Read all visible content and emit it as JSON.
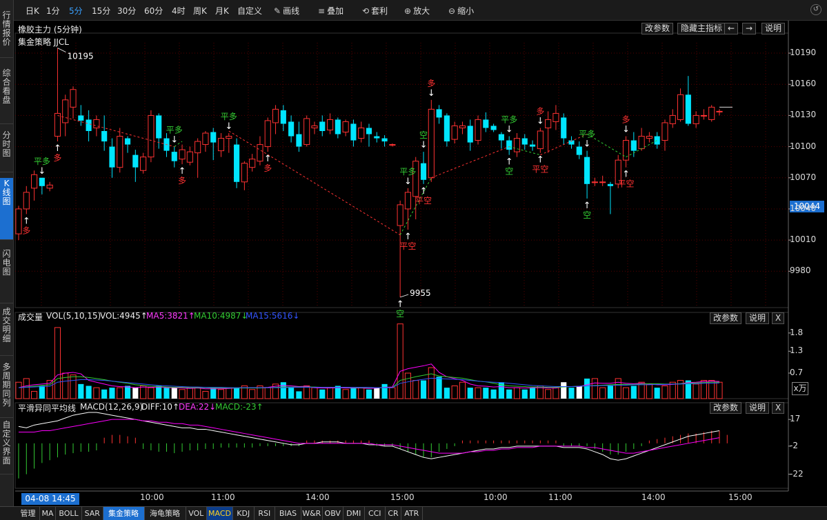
{
  "toolbar": {
    "periods": [
      "日K",
      "1分",
      "5分",
      "15分",
      "30分",
      "60分",
      "4时",
      "周K",
      "月K",
      "自定义"
    ],
    "selected_period": "5分",
    "tools": [
      {
        "label": "画线",
        "icon": "pencil-icon"
      },
      {
        "label": "叠加",
        "icon": "stack-icon"
      },
      {
        "label": "套利",
        "icon": "arbitrage-icon"
      },
      {
        "label": "放大",
        "icon": "zoom-in-icon"
      },
      {
        "label": "缩小",
        "icon": "zoom-out-icon"
      }
    ]
  },
  "sidebar": {
    "tabs": [
      "行情报价",
      "综合看盘",
      "分时图",
      "K线图",
      "闪电图",
      "成交明细",
      "多周期同列",
      "自定义界面"
    ],
    "active": "K线图"
  },
  "price_panel": {
    "title": "橡胶主力 (5分钟)",
    "strategy_label": "集金策略 JJCL",
    "buttons": [
      "改参数",
      "隐藏主指标",
      "←",
      "→",
      "说明"
    ],
    "high_label": "10195",
    "low_label": "9955",
    "current_price": "10044",
    "y_ticks": [
      "10190",
      "10160",
      "10130",
      "10100",
      "10070",
      "10040",
      "10010",
      "9980"
    ]
  },
  "volume_panel": {
    "name": "成交量",
    "params": "VOL(5,10,15)",
    "vol": "VOL:4945↑",
    "ma5": "MA5:3821↑",
    "ma10": "MA10:4987↓",
    "ma15": "MA15:5616↓",
    "buttons": [
      "改参数",
      "说明",
      "X"
    ],
    "y_ticks": [
      "1.8",
      "1.3",
      "0.7"
    ],
    "unit": "x万"
  },
  "macd_panel": {
    "name": "平滑异同平均线",
    "params": "MACD(12,26,9)",
    "diff": "DIFF:10↑",
    "dea": "DEA:22↓",
    "macd": "MACD:-23↑",
    "buttons": [
      "改参数",
      "说明",
      "X"
    ],
    "y_ticks": [
      "17",
      "-2",
      "-22"
    ]
  },
  "time_axis": {
    "current": "04-08 14:45",
    "ticks": [
      "10:00",
      "11:00",
      "14:00",
      "15:00",
      "10:00",
      "11:00",
      "14:00",
      "15:00"
    ]
  },
  "bottom_tabs": [
    "管理",
    "MA",
    "BOLL",
    "SAR",
    "集金策略",
    "海龟策略",
    "VOL",
    "MACD",
    "KDJ",
    "RSI",
    "BIAS",
    "W&R",
    "OBV",
    "DMI",
    "CCI",
    "CR",
    "ATR"
  ],
  "bottom_active": "集金策略",
  "bottom_highlight": "MACD",
  "colors": {
    "up": "#ff3232",
    "down": "#00e5ff",
    "signal_long": "#ff3232",
    "signal_short": "#33cc33",
    "ma5": "#ff00ff",
    "ma10": "#33cc33",
    "ma15": "#3355ff",
    "accent": "#1c6fd0"
  },
  "chart_data": {
    "type": "candlestick",
    "bars": [
      [
        10016,
        10040,
        10010,
        10043
      ],
      [
        10040,
        10056,
        10035,
        10062
      ],
      [
        10060,
        10073,
        10048,
        10077
      ],
      [
        10070,
        10062,
        10054,
        10070
      ],
      [
        10060,
        10063,
        10057,
        10066
      ],
      [
        10110,
        10132,
        10105,
        10195
      ],
      [
        10123,
        10145,
        10110,
        10150
      ],
      [
        10138,
        10155,
        10127,
        10158
      ],
      [
        10130,
        10125,
        10120,
        10140
      ],
      [
        10126,
        10115,
        10105,
        10135
      ],
      [
        10118,
        10126,
        10110,
        10130
      ],
      [
        10115,
        10105,
        10096,
        10130
      ],
      [
        10100,
        10080,
        10070,
        10108
      ],
      [
        10080,
        10110,
        10075,
        10118
      ],
      [
        10108,
        10102,
        10094,
        10110
      ],
      [
        10092,
        10080,
        10066,
        10097
      ],
      [
        10077,
        10090,
        10074,
        10094
      ],
      [
        10090,
        10130,
        10085,
        10135
      ],
      [
        10130,
        10108,
        10098,
        10132
      ],
      [
        10108,
        10096,
        10090,
        10113
      ],
      [
        10095,
        10086,
        10080,
        10100
      ],
      [
        10088,
        10097,
        10083,
        10102
      ],
      [
        10085,
        10095,
        10082,
        10100
      ],
      [
        10094,
        10105,
        10070,
        10108
      ],
      [
        10102,
        10113,
        10095,
        10115
      ],
      [
        10114,
        10104,
        10087,
        10118
      ],
      [
        10096,
        10108,
        10090,
        10113
      ],
      [
        10108,
        10110,
        10094,
        10113
      ],
      [
        10102,
        10066,
        10060,
        10108
      ],
      [
        10066,
        10084,
        10058,
        10086
      ],
      [
        10080,
        10088,
        10076,
        10093
      ],
      [
        10086,
        10102,
        10082,
        10110
      ],
      [
        10100,
        10125,
        10095,
        10128
      ],
      [
        10123,
        10136,
        10112,
        10140
      ],
      [
        10135,
        10122,
        10115,
        10140
      ],
      [
        10124,
        10110,
        10104,
        10130
      ],
      [
        10112,
        10100,
        10095,
        10124
      ],
      [
        10102,
        10127,
        10100,
        10130
      ],
      [
        10118,
        10120,
        10112,
        10124
      ],
      [
        10124,
        10115,
        10110,
        10130
      ],
      [
        10116,
        10126,
        10112,
        10132
      ],
      [
        10126,
        10112,
        10108,
        10128
      ],
      [
        10114,
        10124,
        10110,
        10126
      ],
      [
        10122,
        10106,
        10100,
        10126
      ],
      [
        10108,
        10118,
        10104,
        10124
      ],
      [
        10118,
        10112,
        10100,
        10122
      ],
      [
        10110,
        10108,
        10104,
        10114
      ],
      [
        10108,
        10105,
        10100,
        10111
      ],
      [
        10102,
        10102,
        10100,
        10103
      ],
      [
        10024,
        10044,
        9955,
        10048
      ],
      [
        10040,
        10056,
        10020,
        10060
      ],
      [
        10052,
        10086,
        10030,
        10090
      ],
      [
        10084,
        10068,
        10064,
        10095
      ],
      [
        10070,
        10136,
        10066,
        10145
      ],
      [
        10136,
        10128,
        10122,
        10140
      ],
      [
        10130,
        10105,
        10100,
        10132
      ],
      [
        10107,
        10120,
        10103,
        10124
      ],
      [
        10118,
        10120,
        10112,
        10124
      ],
      [
        10120,
        10104,
        10096,
        10126
      ],
      [
        10106,
        10126,
        10102,
        10130
      ],
      [
        10126,
        10118,
        10114,
        10133
      ],
      [
        10120,
        10116,
        10114,
        10122
      ],
      [
        10112,
        10106,
        10098,
        10114
      ],
      [
        10106,
        10097,
        10092,
        10110
      ],
      [
        10095,
        10108,
        10090,
        10113
      ],
      [
        10108,
        10102,
        10097,
        10112
      ],
      [
        10102,
        10100,
        10096,
        10106
      ],
      [
        10098,
        10115,
        10094,
        10118
      ],
      [
        10118,
        10126,
        10094,
        10134
      ],
      [
        10124,
        10132,
        10116,
        10140
      ],
      [
        10128,
        10108,
        10102,
        10132
      ],
      [
        10106,
        10102,
        10098,
        10110
      ],
      [
        10100,
        10092,
        10088,
        10105
      ],
      [
        10090,
        10064,
        10050,
        10096
      ],
      [
        10066,
        10066,
        10062,
        10070
      ],
      [
        10066,
        10066,
        10062,
        10072
      ],
      [
        10064,
        10062,
        10035,
        10066
      ],
      [
        10064,
        10087,
        10060,
        10092
      ],
      [
        10087,
        10106,
        10080,
        10110
      ],
      [
        10106,
        10096,
        10090,
        10114
      ],
      [
        10098,
        10110,
        10096,
        10118
      ],
      [
        10108,
        10110,
        10104,
        10114
      ],
      [
        10110,
        10102,
        10098,
        10114
      ],
      [
        10106,
        10123,
        10096,
        10126
      ],
      [
        10122,
        10130,
        10118,
        10136
      ],
      [
        10126,
        10150,
        10124,
        10156
      ],
      [
        10150,
        10122,
        10120,
        10168
      ],
      [
        10122,
        10130,
        10118,
        10134
      ],
      [
        10130,
        10130,
        10126,
        10136
      ],
      [
        10126,
        10138,
        10124,
        10140
      ],
      [
        10134,
        10134,
        10130,
        10136
      ]
    ],
    "volume": [
      0.45,
      0.55,
      0.2,
      0.35,
      0.5,
      1.95,
      0.7,
      0.65,
      0.4,
      0.35,
      0.3,
      0.25,
      0.3,
      0.3,
      0.35,
      0.3,
      0.35,
      0.3,
      0.35,
      0.3,
      0.3,
      0.25,
      0.3,
      0.3,
      0.2,
      0.3,
      0.25,
      0.3,
      0.3,
      0.35,
      0.25,
      0.35,
      0.3,
      0.4,
      0.45,
      0.3,
      0.2,
      0.35,
      0.3,
      0.25,
      0.3,
      0.35,
      0.25,
      0.3,
      0.3,
      0.25,
      0.3,
      0.4,
      0.3,
      2.05,
      0.7,
      0.5,
      0.5,
      0.85,
      0.6,
      0.3,
      0.35,
      0.45,
      0.3,
      0.3,
      0.3,
      0.25,
      0.45,
      0.25,
      0.3,
      0.25,
      0.3,
      0.35,
      0.25,
      0.3,
      0.45,
      0.3,
      0.35,
      0.55,
      0.55,
      0.3,
      0.35,
      0.55,
      0.3,
      0.35,
      0.45,
      0.4,
      0.3,
      0.35,
      0.45,
      0.5,
      0.5,
      0.4,
      0.5,
      0.5,
      0.45
    ],
    "signals": [
      {
        "i": 1,
        "text": "多",
        "type": "long",
        "pos": "below"
      },
      {
        "i": 3,
        "text": "平多",
        "type": "short",
        "pos": "above"
      },
      {
        "i": 5,
        "text": "多",
        "type": "long",
        "pos": "below"
      },
      {
        "i": 20,
        "text": "平多",
        "type": "short",
        "pos": "above"
      },
      {
        "i": 21,
        "text": "多",
        "type": "long",
        "pos": "below"
      },
      {
        "i": 27,
        "text": "平多",
        "type": "short",
        "pos": "above"
      },
      {
        "i": 32,
        "text": "多",
        "type": "long",
        "pos": "below"
      },
      {
        "i": 49,
        "text": "空",
        "type": "short",
        "pos": "below"
      },
      {
        "i": 50,
        "text": "平多",
        "type": "short",
        "pos": "above"
      },
      {
        "i": 50,
        "text": "平空",
        "type": "long",
        "pos": "below"
      },
      {
        "i": 52,
        "text": "空",
        "type": "short",
        "pos": "above"
      },
      {
        "i": 52,
        "text": "平空",
        "type": "long",
        "pos": "below"
      },
      {
        "i": 53,
        "text": "多",
        "type": "long",
        "pos": "above"
      },
      {
        "i": 63,
        "text": "平多",
        "type": "short",
        "pos": "above"
      },
      {
        "i": 63,
        "text": "空",
        "type": "short",
        "pos": "below"
      },
      {
        "i": 67,
        "text": "多",
        "type": "long",
        "pos": "above"
      },
      {
        "i": 67,
        "text": "平空",
        "type": "long",
        "pos": "below"
      },
      {
        "i": 73,
        "text": "平多",
        "type": "short",
        "pos": "above"
      },
      {
        "i": 73,
        "text": "空",
        "type": "short",
        "pos": "below"
      },
      {
        "i": 78,
        "text": "多",
        "type": "long",
        "pos": "above"
      },
      {
        "i": 78,
        "text": "平空",
        "type": "long",
        "pos": "below"
      }
    ],
    "ma5": [
      0.3,
      0.35,
      0.38,
      0.4,
      0.42,
      0.65,
      0.7,
      0.72,
      0.68,
      0.5,
      0.45,
      0.4,
      0.35,
      0.33,
      0.32,
      0.3,
      0.32,
      0.31,
      0.32,
      0.3,
      0.3,
      0.29,
      0.28,
      0.29,
      0.27,
      0.27,
      0.27,
      0.28,
      0.29,
      0.3,
      0.3,
      0.3,
      0.31,
      0.34,
      0.36,
      0.35,
      0.33,
      0.34,
      0.3,
      0.29,
      0.29,
      0.3,
      0.29,
      0.29,
      0.29,
      0.28,
      0.29,
      0.31,
      0.32,
      0.75,
      0.82,
      0.86,
      0.9,
      0.95,
      0.72,
      0.6,
      0.55,
      0.5,
      0.4,
      0.35,
      0.34,
      0.32,
      0.33,
      0.3,
      0.3,
      0.29,
      0.3,
      0.3,
      0.29,
      0.29,
      0.33,
      0.33,
      0.33,
      0.38,
      0.43,
      0.42,
      0.42,
      0.45,
      0.42,
      0.41,
      0.42,
      0.4,
      0.38,
      0.38,
      0.39,
      0.41,
      0.44,
      0.45,
      0.47,
      0.48,
      0.47
    ],
    "ma10": [
      0.3,
      0.32,
      0.34,
      0.36,
      0.38,
      0.55,
      0.58,
      0.6,
      0.6,
      0.58,
      0.55,
      0.52,
      0.48,
      0.45,
      0.42,
      0.38,
      0.36,
      0.34,
      0.33,
      0.32,
      0.31,
      0.31,
      0.3,
      0.3,
      0.3,
      0.29,
      0.29,
      0.29,
      0.29,
      0.29,
      0.29,
      0.29,
      0.3,
      0.31,
      0.32,
      0.32,
      0.32,
      0.32,
      0.32,
      0.31,
      0.31,
      0.31,
      0.31,
      0.3,
      0.3,
      0.3,
      0.3,
      0.3,
      0.3,
      0.5,
      0.55,
      0.6,
      0.64,
      0.68,
      0.62,
      0.6,
      0.58,
      0.56,
      0.52,
      0.48,
      0.46,
      0.42,
      0.38,
      0.35,
      0.34,
      0.33,
      0.32,
      0.32,
      0.31,
      0.31,
      0.32,
      0.33,
      0.34,
      0.35,
      0.36,
      0.37,
      0.38,
      0.39,
      0.39,
      0.39,
      0.4,
      0.41,
      0.41,
      0.4,
      0.4,
      0.41,
      0.42,
      0.43,
      0.44,
      0.45,
      0.45
    ],
    "ma15": [
      0.3,
      0.31,
      0.32,
      0.33,
      0.34,
      0.45,
      0.48,
      0.5,
      0.52,
      0.52,
      0.51,
      0.5,
      0.48,
      0.46,
      0.44,
      0.42,
      0.4,
      0.38,
      0.36,
      0.35,
      0.34,
      0.33,
      0.32,
      0.32,
      0.31,
      0.31,
      0.31,
      0.3,
      0.3,
      0.3,
      0.3,
      0.3,
      0.3,
      0.3,
      0.3,
      0.31,
      0.31,
      0.31,
      0.31,
      0.31,
      0.31,
      0.31,
      0.31,
      0.31,
      0.31,
      0.31,
      0.3,
      0.3,
      0.3,
      0.42,
      0.46,
      0.5,
      0.53,
      0.56,
      0.55,
      0.54,
      0.53,
      0.52,
      0.5,
      0.48,
      0.46,
      0.45,
      0.44,
      0.42,
      0.4,
      0.38,
      0.36,
      0.35,
      0.34,
      0.33,
      0.33,
      0.33,
      0.34,
      0.35,
      0.35,
      0.36,
      0.36,
      0.37,
      0.37,
      0.38,
      0.38,
      0.38,
      0.39,
      0.39,
      0.4,
      0.4,
      0.41,
      0.41,
      0.42,
      0.42,
      0.43
    ],
    "diff": [
      12,
      11,
      13,
      14,
      15,
      16,
      18,
      20,
      21,
      22,
      22,
      21,
      20,
      19,
      18,
      17,
      16,
      15,
      14,
      13,
      12,
      11,
      11,
      10,
      10,
      9,
      8,
      7,
      6,
      5,
      4,
      3,
      2,
      1,
      0,
      -1,
      -1,
      0,
      0,
      1,
      1,
      1,
      0,
      0,
      0,
      -1,
      -1,
      -2,
      -2,
      -4,
      -6,
      -8,
      -10,
      -11,
      -10,
      -9,
      -8,
      -7,
      -6,
      -5,
      -4,
      -4,
      -3,
      -3,
      -2,
      -2,
      -2,
      -2,
      -2,
      -2,
      -3,
      -3,
      -3,
      -4,
      -6,
      -8,
      -11,
      -12,
      -11,
      -9,
      -7,
      -5,
      -3,
      -1,
      1,
      3,
      5,
      6,
      7,
      8,
      9
    ],
    "dea": [
      8,
      8,
      8,
      9,
      9,
      10,
      11,
      12,
      13,
      14,
      15,
      16,
      17,
      17,
      17,
      17,
      16,
      16,
      15,
      15,
      14,
      14,
      13,
      13,
      12,
      11,
      10,
      9,
      8,
      7,
      6,
      5,
      4,
      3,
      2,
      1,
      0,
      0,
      0,
      0,
      0,
      0,
      0,
      0,
      0,
      0,
      -1,
      -1,
      -1,
      -2,
      -3,
      -4,
      -5,
      -6,
      -7,
      -7,
      -7,
      -7,
      -6,
      -6,
      -5,
      -5,
      -4,
      -4,
      -3,
      -3,
      -3,
      -2,
      -2,
      -2,
      -2,
      -2,
      -2,
      -3,
      -3,
      -4,
      -5,
      -6,
      -7,
      -7,
      -6,
      -5,
      -4,
      -3,
      -2,
      -1,
      0,
      1,
      2,
      3,
      4
    ],
    "macd_hist": [
      -25,
      -22,
      -18,
      -14,
      -12,
      -10,
      -8,
      -7,
      -6,
      -6,
      -5,
      4,
      6,
      6,
      5,
      4,
      -4,
      -5,
      -6,
      -6,
      -7,
      -6,
      -5,
      -5,
      -4,
      -4,
      -3,
      -3,
      -3,
      -3,
      -3,
      -2,
      -2,
      -2,
      -2,
      -2,
      -2,
      2,
      2,
      2,
      2,
      2,
      2,
      2,
      2,
      2,
      -2,
      -2,
      -2,
      -4,
      -6,
      -8,
      -10,
      -10,
      -6,
      -4,
      -2,
      2,
      2,
      2,
      2,
      2,
      2,
      2,
      2,
      2,
      2,
      2,
      2,
      2,
      -2,
      -2,
      -2,
      -2,
      -4,
      -6,
      -8,
      -8,
      -6,
      -4,
      -2,
      2,
      3,
      4,
      5,
      6,
      7,
      7,
      8,
      9,
      9,
      6
    ],
    "price_range": [
      9945,
      10200
    ],
    "volume_range": [
      0,
      2.1
    ],
    "macd_range": [
      -32,
      22
    ]
  }
}
